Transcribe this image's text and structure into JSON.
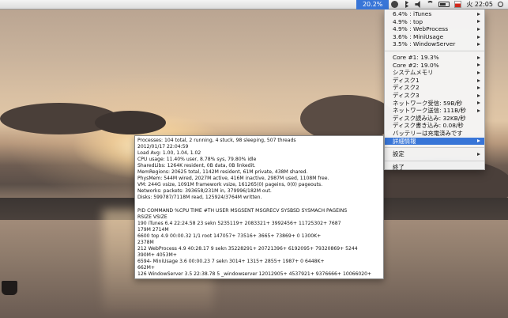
{
  "menubar": {
    "cpu": "20.2%",
    "clock": "火 22:05",
    "icons": [
      "time-machine-icon",
      "bluetooth-icon",
      "volume-icon",
      "wifi-icon",
      "battery-icon",
      "flag-icon",
      "spotlight-icon"
    ]
  },
  "menu": {
    "processes": [
      "6.4% : iTunes",
      "4.9% : top",
      "4.9% : WebProcess",
      "3.6% : MiniUsage",
      "3.5% : WindowServer"
    ],
    "stats": [
      "Core #1: 19.3%",
      "Core #2: 19.0%",
      "システムメモリ",
      "ディスク1",
      "ディスク2",
      "ディスク3",
      "ネットワーク受信: 59B/秒",
      "ネットワーク送信: 111B/秒",
      "ディスク読み込み: 32KB/秒",
      "ディスク書き込み: 0.08/秒",
      "バッテリーは充電済みです"
    ],
    "details_label": "詳細情報",
    "settings_label": "設定",
    "quit_label": "終了"
  },
  "detail": {
    "lines": [
      "Processes: 104 total, 2 running, 4 stuck, 98 sleeping, 507 threads",
      "2012/01/17 22:04:59",
      "Load Avg: 1.00, 1.04, 1.02",
      "CPU usage: 11.40% user, 8.78% sys, 79.80% idle",
      "SharedLibs: 1264K resident, 0B data, 0B linkedit.",
      "MemRegions: 20625 total, 1142M resident, 61M private, 438M shared.",
      "PhysMem: 544M wired, 2027M active, 416M inactive, 2987M used, 1108M free.",
      "VM: 244G vsize, 1091M framework vsize, 161265(0) pageins, 0(0) pageouts.",
      "Networks: packets: 393658/231M in, 379996/182M out.",
      "Disks: 599787/7118M read, 125924/3764M written.",
      "",
      "PID   COMMAND      %CPU TIME    #TH  USER         MSGSENT    MSGRECV    SYSBSD   SYSMACH   PAGEINS",
      "RSIZE  VSIZE",
      "190   iTunes         6.4  22:24.58 23    sekn          5235119+   2083321+   3992456+  11725302+ 7687",
      "179M   2714M",
      "6600  top            4.9   00:00.32 1/1   root          147057+    73516+     3665+      73869+    0      1300K+",
      "2378M",
      "212   WebProcess     4.9   40:28.17 9     sekn          35228291+  20721396+  6192095+  79320869+ 5244",
      "390M+  4053M+",
      "6594-  MiniUsage      3.6   00:00.23 7     sekn          3014+      1315+      2855+      1987+     0      6448K+",
      "662M+",
      "126   WindowServer 3.5  22:38.78 5     _windowserver 12012905+  4537921+   9376666+  10066020+"
    ]
  }
}
